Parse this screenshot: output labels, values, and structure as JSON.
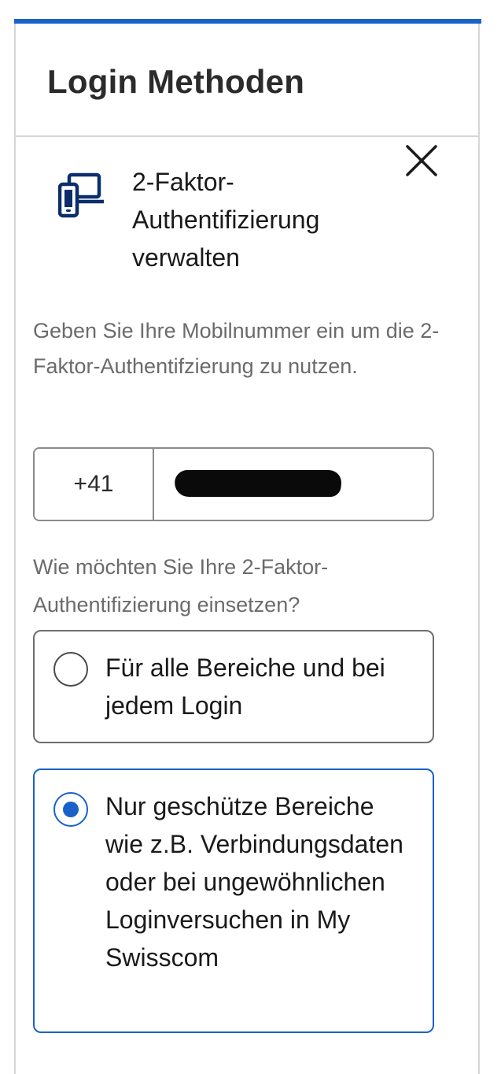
{
  "header": {
    "title": "Login Methoden"
  },
  "section": {
    "title": "2-Faktor-Authentifizierung verwalten",
    "icon": "devices-icon"
  },
  "description": "Geben Sie Ihre Mobilnummer ein um die 2-Faktor-Authentifzierung zu nutzen.",
  "phone": {
    "country_code": "+41",
    "number_redacted": true
  },
  "question": "Wie möchten Sie Ihre 2-Faktor-Authentifizierung einsetzen?",
  "options": [
    {
      "label": "Für alle Bereiche und bei jedem Login",
      "selected": false
    },
    {
      "label": "Nur geschütze Bereiche wie z.B. Verbindungsdaten oder bei ungewöhnlichen Loginversuchen in My Swisscom",
      "selected": true
    }
  ],
  "colors": {
    "accent": "#1a62c9",
    "icon": "#0b2e6b",
    "muted_text": "#6b6b6b",
    "border": "#d6d6d6"
  }
}
